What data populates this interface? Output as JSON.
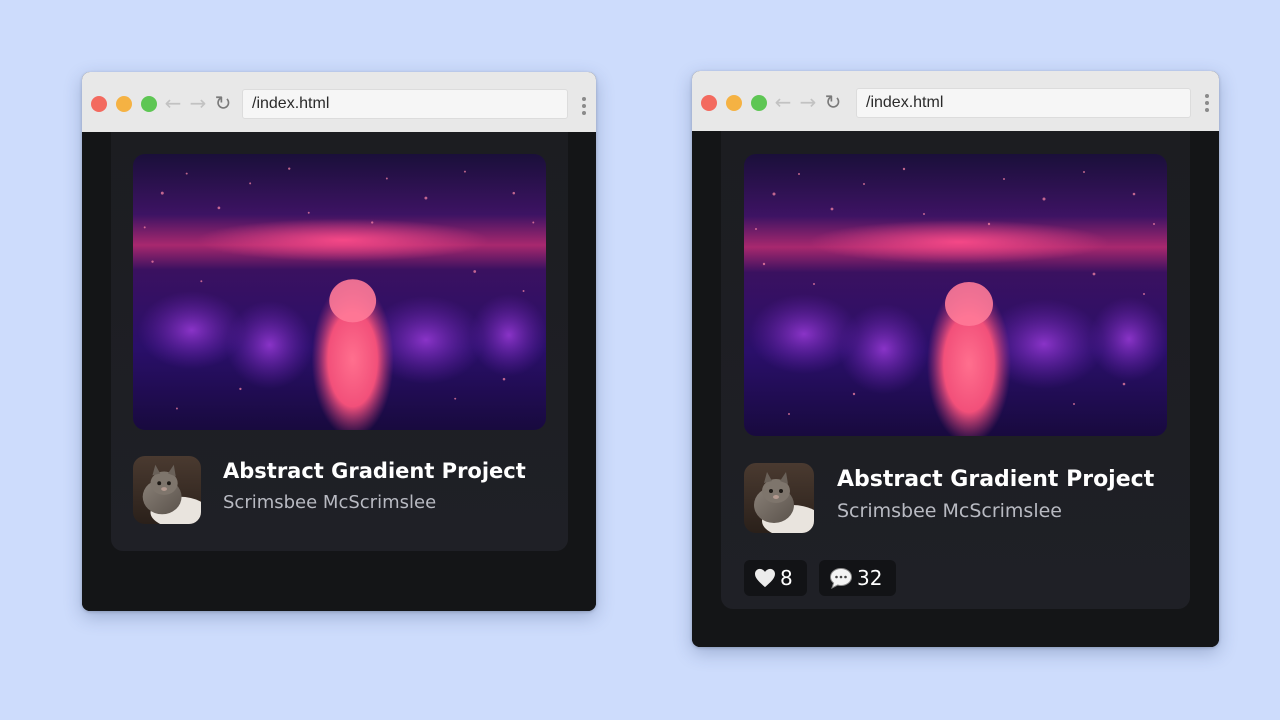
{
  "windows": [
    {
      "url": "/index.html",
      "card": {
        "title": "Abstract Gradient Project",
        "author": "Scrimsbee McScrimslee"
      }
    },
    {
      "url": "/index.html",
      "card": {
        "title": "Abstract Gradient Project",
        "author": "Scrimsbee McScrimslee",
        "likes": "8",
        "comments": "32"
      }
    }
  ],
  "icons": {
    "back": "arrow-left-icon",
    "forward": "arrow-right-icon",
    "reload": "reload-icon",
    "menu": "more-vertical-icon",
    "likes": "heart-icon",
    "comments": "speech-bubble-icon"
  },
  "colors": {
    "page_background": "#cddcfc",
    "card_background": "#1e1f24",
    "title_text": "#ffffff",
    "author_text": "#b8bac2",
    "traffic_red": "#f36a5f",
    "traffic_yellow": "#f5b243",
    "traffic_green": "#5ec654"
  }
}
